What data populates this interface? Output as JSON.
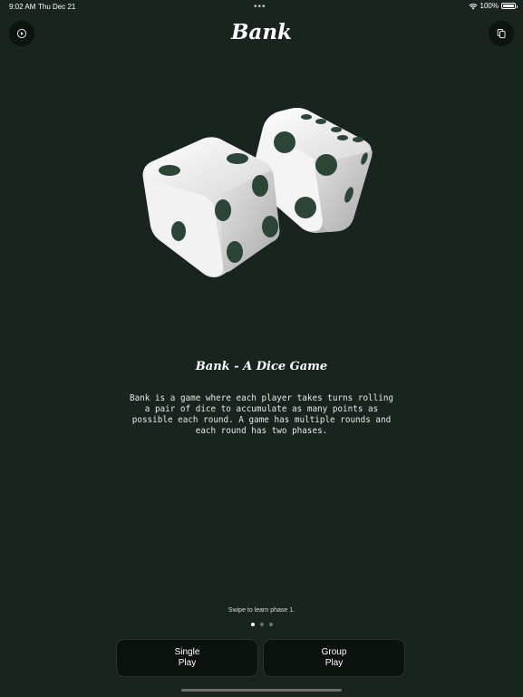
{
  "status_bar": {
    "time": "9:02 AM",
    "date": "Thu Dec 21",
    "multitask_dots": "•••",
    "battery_text": "100%",
    "battery_level": 1.0,
    "wifi_icon": "wifi-icon",
    "battery_icon": "battery-icon"
  },
  "header": {
    "title": "Bank",
    "left_button_icon": "play-circle-icon",
    "right_button_icon": "copy-icon"
  },
  "intro": {
    "image_icon": "dice-icon",
    "heading": "Bank - A Dice Game",
    "body_lines": [
      "Bank is a game where each player takes turns rolling",
      "a pair of dice to accumulate as many points as",
      "possible each round. A game has multiple rounds and",
      "each round has two phases."
    ],
    "swipe_hint": "Swipe to learn phase 1.",
    "page_count": 3,
    "current_page": 1
  },
  "actions": {
    "single_play": [
      "Single",
      "Play"
    ],
    "group_play": [
      "Group",
      "Play"
    ]
  },
  "colors": {
    "background": "#18241d",
    "button": "#0c120e",
    "pip": "#2b4536",
    "die_face": "#f2f2f2"
  }
}
